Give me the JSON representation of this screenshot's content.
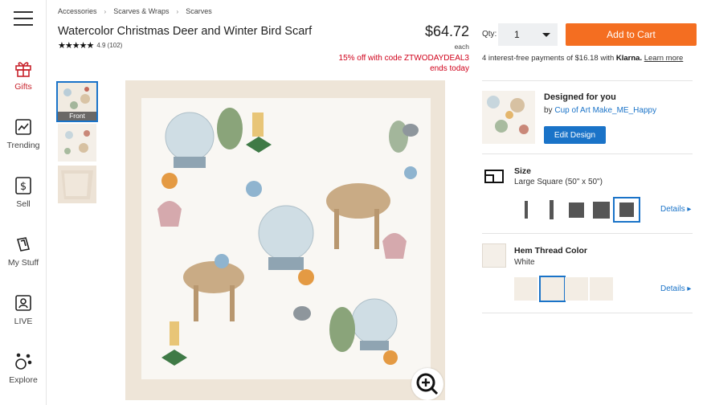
{
  "nav": {
    "items": [
      {
        "label": "Gifts",
        "icon": "gift-icon"
      },
      {
        "label": "Trending",
        "icon": "trending-icon"
      },
      {
        "label": "Sell",
        "icon": "sell-icon"
      },
      {
        "label": "My Stuff",
        "icon": "my-stuff-icon"
      },
      {
        "label": "LIVE",
        "icon": "live-icon"
      },
      {
        "label": "Explore",
        "icon": "explore-icon"
      }
    ]
  },
  "breadcrumb": [
    "Accessories",
    "Scarves & Wraps",
    "Scarves"
  ],
  "product": {
    "title": "Watercolor Christmas Deer and Winter Bird Scarf",
    "rating": "4.9",
    "reviews": "(102)",
    "price": "$64.72",
    "price_unit": "each",
    "promo_line1": "15% off with code ZTWODAYDEAL3",
    "promo_line2": "ends today"
  },
  "gallery": {
    "front_label": "Front"
  },
  "purchase": {
    "qty_label": "Qty:",
    "qty_value": "1",
    "cart_button": "Add to Cart",
    "installments_prefix": "4 interest-free payments of $16.18 with",
    "installments_brand": "Klarna.",
    "installments_link": "Learn more"
  },
  "design": {
    "title": "Designed for you",
    "by_prefix": "by",
    "author": "Cup of Art Make_ME_Happy",
    "edit_button": "Edit Design"
  },
  "size": {
    "title": "Size",
    "value": "Large Square (50\" x 50\")",
    "details": "Details"
  },
  "hem": {
    "title": "Hem Thread Color",
    "value": "White",
    "details": "Details"
  },
  "colors": {
    "accent_blue": "#1a73c8",
    "cart_orange": "#f46e21",
    "promo_red": "#d0021b",
    "active_nav": "#c8232c"
  }
}
